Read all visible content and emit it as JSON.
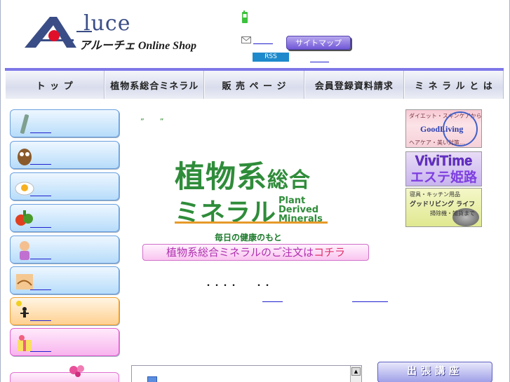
{
  "header": {
    "logo_word": "luce",
    "logo_sub": "アルーチェ Online Shop",
    "sitemap_label": "サイトマップ",
    "rss_label": "RSS"
  },
  "nav": {
    "items": [
      "ト ッ プ",
      "植物系総合ミネラル",
      "販 売 ペ ー ジ",
      "会員登録資料請求",
      "ミ ネ ラ ル と は"
    ]
  },
  "main": {
    "quote_marks": "”　　”",
    "mineral_title_big": "植物系",
    "mineral_title_small": "総合",
    "mineral_title_2": "ミネラル",
    "mineral_en": "Plant Derived Minerals",
    "tagline": "毎日の健康のもと",
    "order_banner": "植物系総合ミネラルのご注文は",
    "order_banner_link": "コチラ",
    "dots_line": "・・・・　　・・"
  },
  "right": {
    "goodliving_top": "ダイエット・スキンケアから",
    "goodliving_name": "GoodLiving",
    "goodliving_bottom": "ヘアケア・美い対策...",
    "vivitime_1": "ViviTime",
    "vivitime_2": "エステ姫路",
    "kitchen_1": "寝具・キッチン用品",
    "kitchen_2": "グッドリビング ライフ",
    "kitchen_3": "掃除機・雑貨まで",
    "shucho_label": "出張講座"
  },
  "colors": {
    "nav_border": "#7d77e8",
    "mineral_green": "#2f8c3a",
    "accent_orange": "#e69a2a",
    "logo_blue": "#3a4d86"
  }
}
